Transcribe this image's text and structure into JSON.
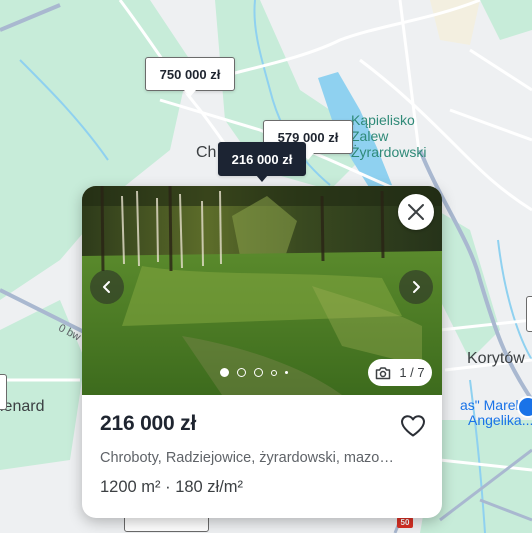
{
  "map": {
    "labels": {
      "poi_lake": [
        "Kąpielisko",
        "Zalew",
        "Żyrardowski"
      ],
      "town_partial": "Ch",
      "town_korytow": "Korytów",
      "town_left": "lenard",
      "road_name": "0 bw",
      "poi_business": [
        "as\" Marek,",
        "Angelika..."
      ],
      "highway_number": "50"
    },
    "colors": {
      "land": "#eef0f2",
      "forest": "#c7ecd9",
      "water": "#8fd1f0",
      "road": "#ffffff",
      "arterial": "#a9b8d0"
    }
  },
  "pins": {
    "pin1": "750 000 zł",
    "pin2": "579 000 zł",
    "pin_active": "216 000 zł"
  },
  "card": {
    "icons": {
      "close": "close-icon",
      "prev": "chevron-left-icon",
      "next": "chevron-right-icon",
      "camera": "camera-icon",
      "favorite": "heart-icon"
    },
    "photo_counter": "1 / 7",
    "price": "216 000 zł",
    "location": "Chroboty, Radziejowice, żyrardowski, mazo…",
    "details": "1200 m² · 180 zł/m²"
  }
}
